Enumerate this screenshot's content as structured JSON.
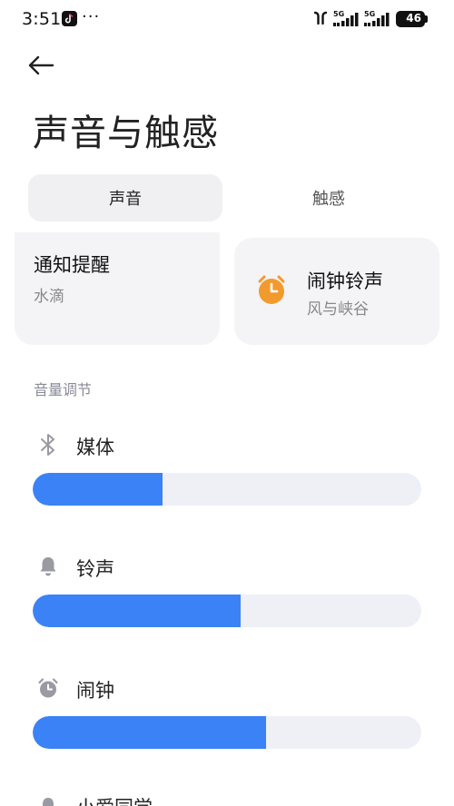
{
  "status_bar": {
    "time": "3:51",
    "more": "···",
    "network_1": "5G",
    "network_2": "5G",
    "battery": "46"
  },
  "page": {
    "title": "声音与触感"
  },
  "tabs": [
    {
      "label": "声音",
      "active": true
    },
    {
      "label": "触感",
      "active": false
    }
  ],
  "cards": {
    "notification": {
      "title": "通知提醒",
      "value": "水滴"
    },
    "alarm": {
      "title": "闹钟铃声",
      "value": "风与峡谷",
      "icon": "alarm-clock-icon",
      "icon_color": "#f39a2e"
    }
  },
  "volume": {
    "section_label": "音量调节",
    "accent": "#3b82f6",
    "track_color": "#eef0f6",
    "rows": [
      {
        "label": "媒体",
        "icon": "bluetooth-icon",
        "level": 0.335
      },
      {
        "label": "铃声",
        "icon": "bell-icon",
        "level": 0.535
      },
      {
        "label": "闹钟",
        "icon": "alarm-clock-icon",
        "level": 0.6
      },
      {
        "label": "小爱同学",
        "icon": "assistant-icon"
      }
    ]
  }
}
